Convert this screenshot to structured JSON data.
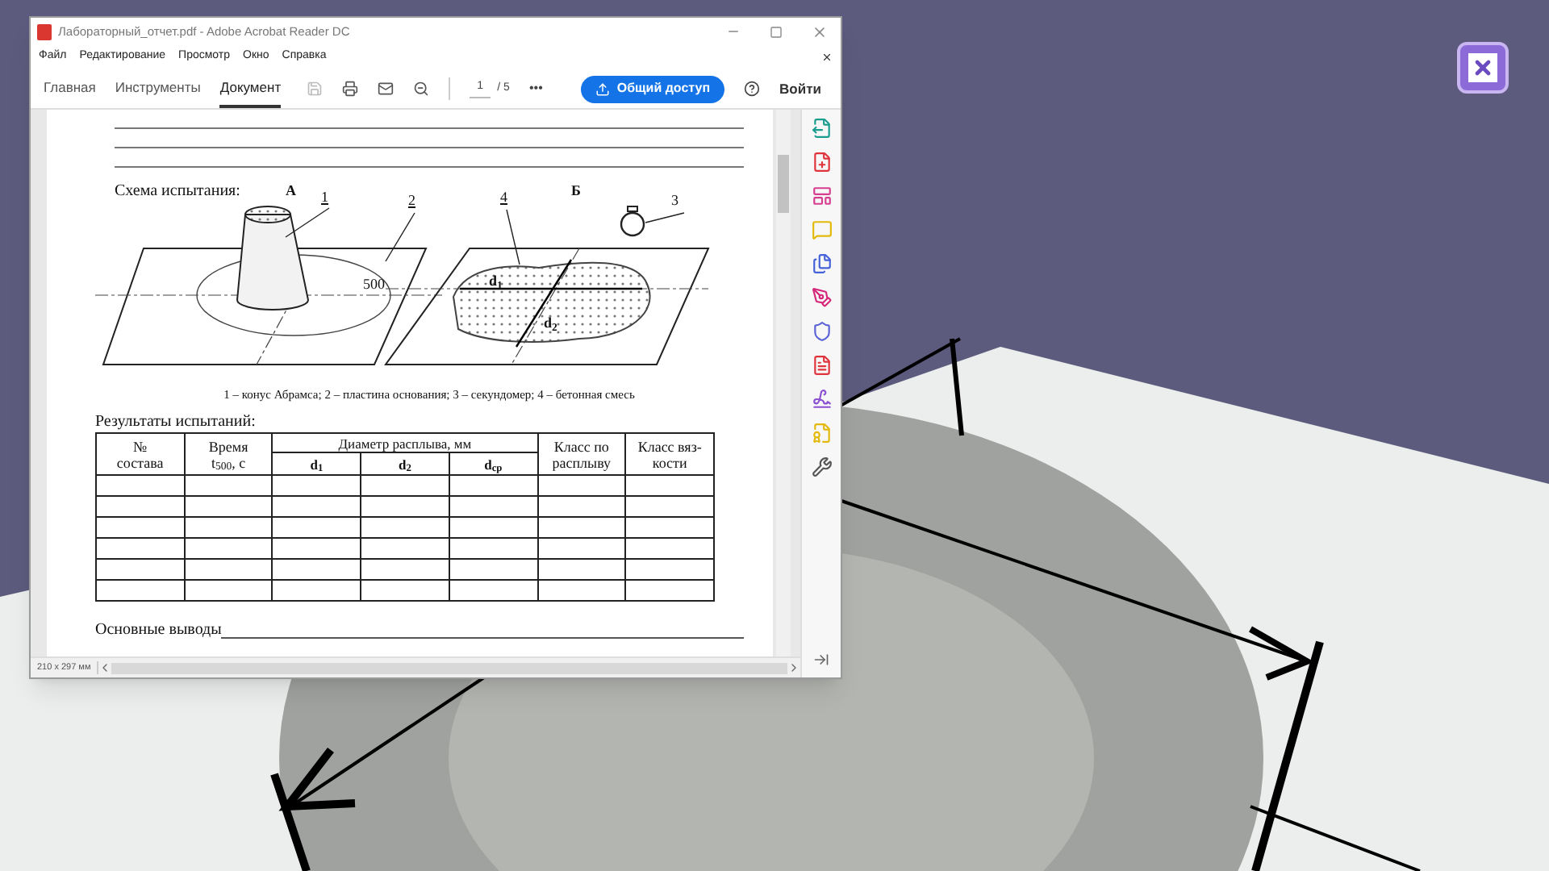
{
  "window": {
    "title": "Лабораторный_отчет.pdf - Adobe Acrobat Reader DC"
  },
  "menu": [
    "Файл",
    "Редактирование",
    "Просмотр",
    "Окно",
    "Справка"
  ],
  "tabs": [
    {
      "label": "Главная",
      "selected": false
    },
    {
      "label": "Инструменты",
      "selected": false
    },
    {
      "label": "Документ",
      "selected": true
    }
  ],
  "toolbar": {
    "page": "1",
    "page_total": "/ 5",
    "more": "•••",
    "share_button": "Общий доступ",
    "login_button": "Войти"
  },
  "document": {
    "scheme_title": "Схема испытания:",
    "diagram_labels": [
      {
        "kind": "A",
        "text": "А"
      },
      {
        "kind": "n1",
        "text": "1"
      },
      {
        "kind": "n2",
        "text": "2"
      },
      {
        "kind": "n4",
        "text": "4"
      },
      {
        "kind": "B",
        "text": "Б"
      },
      {
        "kind": "n3",
        "text": "3"
      },
      {
        "kind": "dim",
        "text": "500"
      },
      {
        "kind": "d1",
        "text": "d$_{1}$"
      },
      {
        "kind": "d2",
        "text": "d$_{2}$"
      }
    ],
    "caption": "1 – конус Абрамса; 2 – пластина основания; 3 – секундомер; 4 – бетонная смесь",
    "results_title": "Результаты испытаний:",
    "table": {
      "columns": [
        {
          "label": "№\nсостава"
        },
        {
          "label": "Время\nt$_{500}$, с"
        },
        {
          "label": "Диаметр расплыва, мм",
          "children": [
            "d$_{1}$",
            "d$_{2}$",
            "d$_{ср}$"
          ]
        },
        {
          "label": "Класс по\nрасплыву"
        },
        {
          "label": "Класс вяз-\nкости"
        }
      ]
    },
    "conclusions": "Основные выводы"
  },
  "status_bar": {
    "page_size": "210 x 297 мм"
  }
}
